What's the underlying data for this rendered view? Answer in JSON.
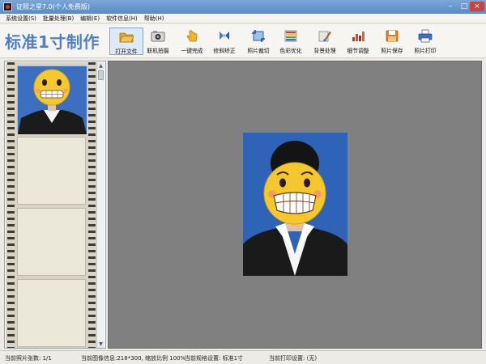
{
  "window": {
    "title": "证照之星7.0(个人免费版)",
    "controls": {
      "minimize": "–",
      "maximize": "□",
      "close": "×"
    }
  },
  "menu": {
    "items": [
      "系统设置(S)",
      "批量处理(B)",
      "编辑(E)",
      "软件信息(H)",
      "帮助(H)"
    ]
  },
  "toolbar": {
    "brand": "标准1寸制作",
    "tools": [
      {
        "label": "打开文件",
        "icon": "folder-open-icon"
      },
      {
        "label": "联机拍摄",
        "icon": "camera-icon"
      },
      {
        "label": "一键完成",
        "icon": "one-click-hand-icon"
      },
      {
        "label": "修斜矫正",
        "icon": "rotate-correct-icon"
      },
      {
        "label": "照片裁切",
        "icon": "crop-icon"
      },
      {
        "label": "色彩优化",
        "icon": "color-bars-icon"
      },
      {
        "label": "背景处理",
        "icon": "background-brush-icon"
      },
      {
        "label": "细节调整",
        "icon": "detail-chart-icon"
      },
      {
        "label": "照片保存",
        "icon": "save-disk-icon"
      },
      {
        "label": "照片打印",
        "icon": "printer-icon"
      }
    ],
    "active_index": 0
  },
  "status": {
    "count": "当前照片张数: 1/1",
    "image_info": "当前图像信息:218*300, 缩放比例 100%",
    "spec": "当前规格设置: 标准1寸",
    "print": "当前打印设置: (无)"
  },
  "colors": {
    "brand": "#4f7fc4",
    "photo_bg": "#2f63b8",
    "workarea_bg": "#808080",
    "film_frame": "#ebe8d9"
  }
}
